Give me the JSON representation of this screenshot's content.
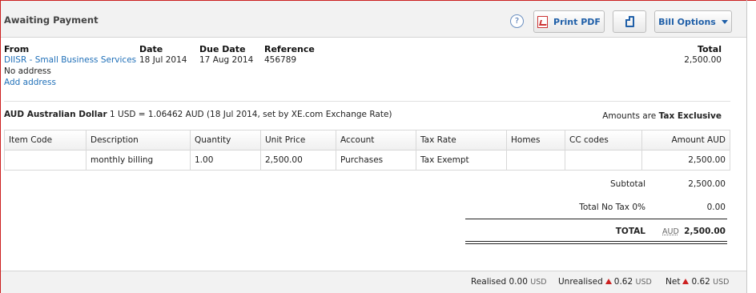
{
  "header": {
    "title": "Awaiting Payment",
    "help_label": "?",
    "print_label": "Print PDF",
    "bill_options_label": "Bill Options"
  },
  "info": {
    "from_label": "From",
    "from_value": "DIISR - Small Business Services",
    "address_value": "No address",
    "add_address_label": "Add address",
    "date_label": "Date",
    "date_value": "18 Jul 2014",
    "due_label": "Due Date",
    "due_value": "17 Aug 2014",
    "ref_label": "Reference",
    "ref_value": "456789",
    "total_label": "Total",
    "total_value": "2,500.00"
  },
  "currency": {
    "code_label": "AUD Australian Dollar",
    "rate_text": "1 USD = 1.06462 AUD (18 Jul 2014, set by XE.com Exchange Rate)",
    "amounts_prefix": "Amounts are",
    "amounts_mode": "Tax Exclusive"
  },
  "table": {
    "columns": [
      "Item Code",
      "Description",
      "Quantity",
      "Unit Price",
      "Account",
      "Tax Rate",
      "Homes",
      "CC codes",
      "Amount AUD"
    ],
    "rows": [
      [
        "",
        "monthly billing",
        "1.00",
        "2,500.00",
        "Purchases",
        "Tax Exempt",
        "",
        "",
        "2,500.00"
      ]
    ]
  },
  "totals": {
    "subtotal_label": "Subtotal",
    "subtotal_value": "2,500.00",
    "notax_label": "Total No Tax 0%",
    "notax_value": "0.00",
    "total_label": "TOTAL",
    "total_currency": "AUD",
    "total_value": "2,500.00"
  },
  "footer": {
    "realised_label": "Realised",
    "realised_value": "0.00",
    "realised_ccy": "USD",
    "unrealised_label": "Unrealised",
    "unrealised_value": "0.62",
    "unrealised_ccy": "USD",
    "net_label": "Net",
    "net_value": "0.62",
    "net_ccy": "USD"
  }
}
